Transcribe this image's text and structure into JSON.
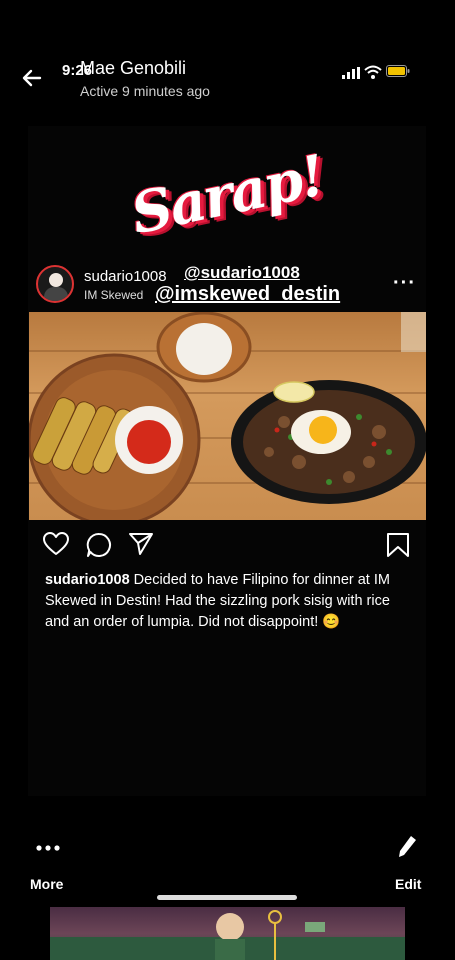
{
  "status_bar": {
    "time": "9:26"
  },
  "header": {
    "contact_name": "Mae Genobili",
    "contact_status": "Active 9 minutes ago"
  },
  "story": {
    "logo_text": "Sarap!",
    "post": {
      "username": "sudario1008",
      "location": "IM Skewed",
      "mention_user": "@sudario1008",
      "mention_place": "@imskewed_destin",
      "more": "···",
      "caption_username": "sudario1008",
      "caption_text": "Decided to have Filipino for dinner at IM Skewed in Destin! Had the sizzling pork sisig with rice and an order of lumpia. Did not disappoint! 😊"
    }
  },
  "bottom_bar": {
    "more_label": "More",
    "edit_label": "Edit"
  },
  "colors": {
    "background": "#000000",
    "logo_red": "#e51b3f",
    "text": "#ffffff"
  }
}
